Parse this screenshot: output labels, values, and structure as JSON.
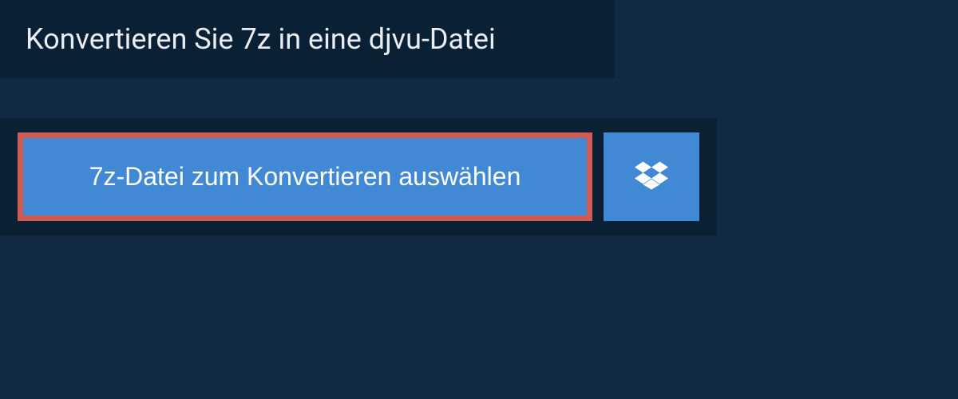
{
  "header": {
    "title": "Konvertieren Sie 7z in eine djvu-Datei"
  },
  "upload": {
    "select_button_label": "7z-Datei zum Konvertieren auswählen"
  },
  "colors": {
    "page_bg": "#0f2a42",
    "panel_bg": "#0a2034",
    "button_bg": "#4189d4",
    "highlight_border": "#d15a52",
    "text_light": "#e8eef4"
  }
}
